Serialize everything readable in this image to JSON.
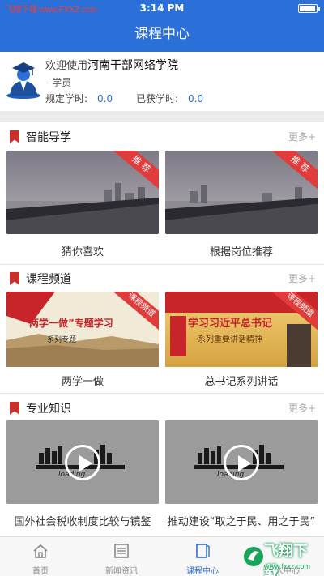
{
  "status_bar": {
    "carrier": "飞翔下载 www.FXXZ.com",
    "time": "3:14 PM"
  },
  "nav": {
    "title": "课程中心"
  },
  "profile": {
    "welcome_prefix": "欢迎使用",
    "school": "河南干部网络学院",
    "role": "- 学员",
    "required_label": "规定学时:",
    "required_value": "0.0",
    "earned_label": "已获学时:",
    "earned_value": "0.0"
  },
  "sections": [
    {
      "title": "智能导学",
      "more": "更多+",
      "cards": [
        {
          "label": "猜你喜欢",
          "badge": "推 荐"
        },
        {
          "label": "根据岗位推荐",
          "badge": "推 荐"
        }
      ]
    },
    {
      "title": "课程频道",
      "more": "更多+",
      "cards": [
        {
          "label": "两学一做",
          "badge": "课程频道",
          "banner": "“两学一做”专题学习",
          "sub": "系列专题"
        },
        {
          "label": "总书记系列讲话",
          "badge": "课程频道",
          "banner": "学习习近平总书记",
          "sub": "系列重要讲话精神"
        }
      ]
    },
    {
      "title": "专业知识",
      "more": "更多+",
      "cards": [
        {
          "label": "国外社会税收制度比较与镜鉴",
          "loading": "loading..."
        },
        {
          "label": "推动建设“取之于民、用之于民”",
          "loading": "loading..."
        }
      ]
    }
  ],
  "tabbar": {
    "items": [
      {
        "label": "首页",
        "icon": "home-icon"
      },
      {
        "label": "新闻资讯",
        "icon": "news-icon"
      },
      {
        "label": "课程中心",
        "icon": "course-icon"
      },
      {
        "label": "个人中心",
        "icon": "user-icon"
      }
    ],
    "active_index": 2
  },
  "watermark": {
    "title": "飞翔下载",
    "url": "www.fxxz.com"
  },
  "colors": {
    "brand": "#2b6fd8",
    "accent_red": "#c9302c"
  }
}
